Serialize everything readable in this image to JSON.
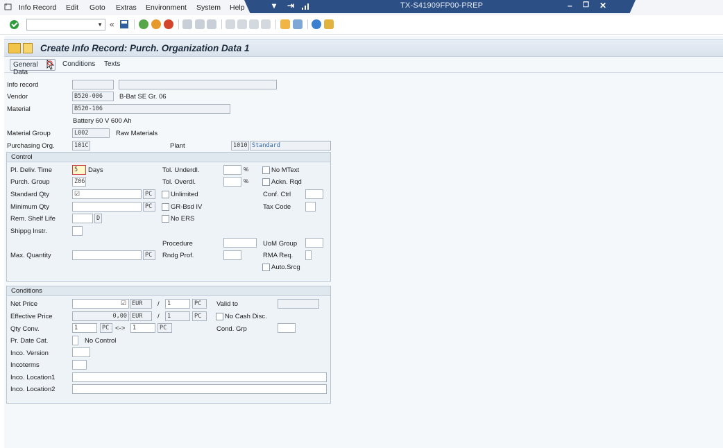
{
  "menu": {
    "items": [
      "Info Record",
      "Edit",
      "Goto",
      "Extras",
      "Environment",
      "System",
      "Help"
    ],
    "system_name": "TX-S41909FP00-PREP"
  },
  "toolbar": {
    "command_value": ""
  },
  "header": {
    "title": "Create Info Record: Purch. Organization Data 1"
  },
  "tabs": [
    "General Data",
    "Conditions",
    "Texts"
  ],
  "general": {
    "info_record": {
      "label": "Info record",
      "value": "",
      "desc": ""
    },
    "vendor": {
      "label": "Vendor",
      "value": "B520-006",
      "desc": "B-Bat SE Gr. 06"
    },
    "material": {
      "label": "Material",
      "value": "B520-106",
      "desc": "Battery 60 V 600 Ah"
    },
    "material_group": {
      "label": "Material Group",
      "value": "L002",
      "desc": "Raw Materials"
    },
    "purchasing_org": {
      "label": "Purchasing Org.",
      "value": "101C"
    },
    "plant": {
      "label": "Plant",
      "value": "1010",
      "desc": "Standard"
    }
  },
  "control": {
    "title": "Control",
    "pl_deliv_time": {
      "label": "Pl. Deliv. Time",
      "value": "5",
      "unit": "Days"
    },
    "purch_group": {
      "label": "Purch. Group",
      "value": "Z06"
    },
    "standard_qty": {
      "label": "Standard Qty",
      "value": "",
      "unit": "PC"
    },
    "minimum_qty": {
      "label": "Minimum Qty",
      "value": "",
      "unit": "PC"
    },
    "rem_shelf_life": {
      "label": "Rem. Shelf Life",
      "value": "",
      "unit": "D"
    },
    "shippg_instr": {
      "label": "Shippg Instr.",
      "value": ""
    },
    "max_quantity": {
      "label": "Max. Quantity",
      "value": "",
      "unit": "PC"
    },
    "tol_underdl": {
      "label": "Tol. Underdl.",
      "value": "",
      "unit": "%"
    },
    "tol_overdl": {
      "label": "Tol. Overdl.",
      "value": "",
      "unit": "%"
    },
    "unlimited": "Unlimited",
    "gr_bsd_iv": "GR-Bsd IV",
    "no_ers": "No ERS",
    "procedure": "Procedure",
    "rndg_prof": "Rndg Prof.",
    "no_mtext": "No MText",
    "ackn_rqd": "Ackn. Rqd",
    "conf_ctrl": "Conf. Ctrl",
    "tax_code": "Tax Code",
    "uom_group": "UoM Group",
    "rma_req": "RMA Req.",
    "auto_srcg": "Auto.Srcg"
  },
  "conditions": {
    "title": "Conditions",
    "net_price": {
      "label": "Net Price",
      "currency": "EUR",
      "per": "1",
      "unit": "PC"
    },
    "valid_to": "Valid to",
    "effective_price": {
      "label": "Effective Price",
      "value": "0,00",
      "currency": "EUR",
      "per": "1",
      "unit": "PC"
    },
    "no_cash_disc": "No Cash Disc.",
    "qty_conv": {
      "label": "Qty Conv.",
      "left": "1",
      "left_unit": "PC",
      "arrow": "<->",
      "right": "1",
      "right_unit": "PC"
    },
    "cond_grp": "Cond. Grp",
    "pr_date_cat": {
      "label": "Pr. Date Cat.",
      "desc": "No Control"
    },
    "inco_version": "Inco. Version",
    "incoterms": "Incoterms",
    "inco_location1": "Inco. Location1",
    "inco_location2": "Inco. Location2",
    "slash": "/"
  }
}
